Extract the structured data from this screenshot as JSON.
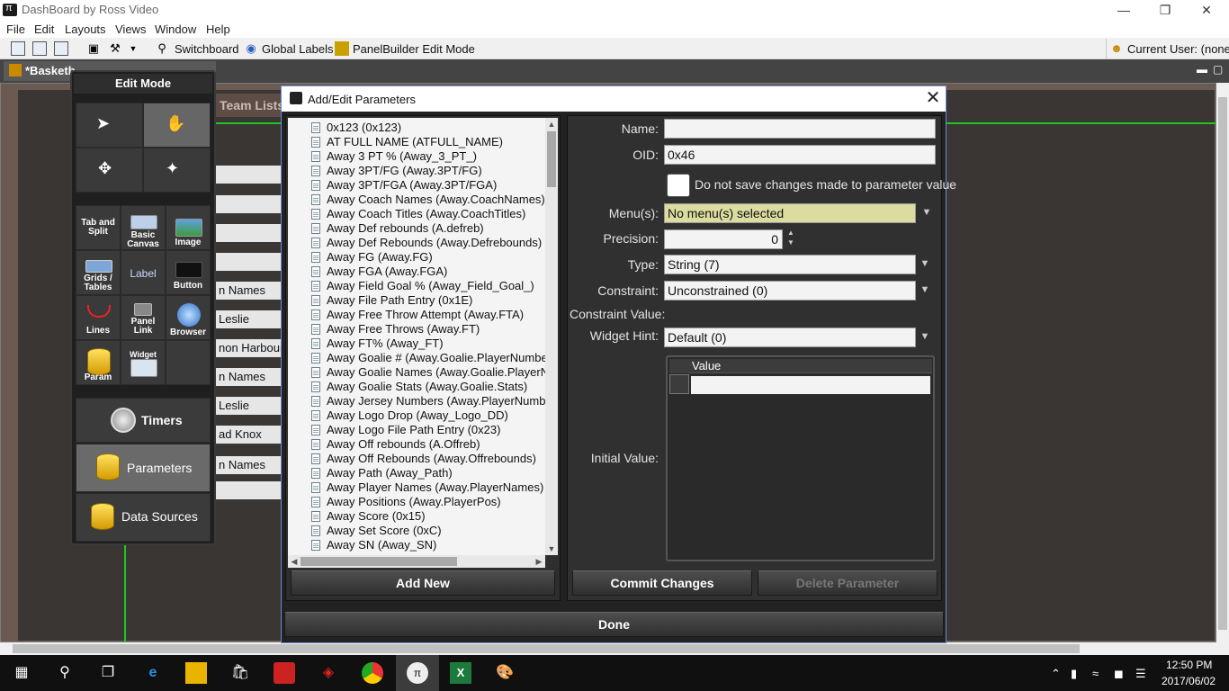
{
  "app": {
    "title": "DashBoard by Ross Video",
    "window_controls": [
      "—",
      "❐",
      "✕"
    ]
  },
  "menu": [
    "File",
    "Edit",
    "Layouts",
    "Views",
    "Window",
    "Help"
  ],
  "toolbar": {
    "switchboard": "Switchboard",
    "global_labels": "Global Labels",
    "panelbuilder": "PanelBuilder Edit Mode",
    "current_user": "Current User: (none)"
  },
  "document_tab": {
    "label": "*Basketb"
  },
  "background_panel": {
    "team_lists": "Team Lists",
    "fields": [
      "",
      "",
      "",
      "",
      "n Names",
      "Leslie",
      "non Harbour",
      "n Names",
      "Leslie",
      "ad Knox",
      "n Names",
      ""
    ]
  },
  "edit_mode": {
    "title": "Edit Mode",
    "tools": [
      {
        "label": "Tab and Split",
        "icon": "tab-split-icon"
      },
      {
        "label": "Basic Canvas",
        "icon": "basic-canvas-icon"
      },
      {
        "label": "Image",
        "icon": "image-icon"
      },
      {
        "label": "Grids / Tables",
        "icon": "grid-icon"
      },
      {
        "label": "Label",
        "icon": "label-icon"
      },
      {
        "label": "Button",
        "icon": "button-icon"
      },
      {
        "label": "Lines",
        "icon": "lines-icon"
      },
      {
        "label": "Panel Link",
        "icon": "panel-link-icon"
      },
      {
        "label": "Browser",
        "icon": "browser-icon"
      },
      {
        "label": "Param",
        "icon": "param-icon"
      },
      {
        "label": "Widget",
        "icon": "widget-icon"
      }
    ],
    "timers": "Timers",
    "parameters": "Parameters",
    "data_sources": "Data Sources"
  },
  "dialog": {
    "title": "Add/Edit Parameters",
    "parameters": [
      "0x123 (0x123)",
      "AT FULL NAME (ATFULL_NAME)",
      "Away 3 PT % (Away_3_PT_)",
      "Away 3PT/FG (Away.3PT/FG)",
      "Away 3PT/FGA (Away.3PT/FGA)",
      "Away Coach Names (Away.CoachNames)",
      "Away Coach Titles (Away.CoachTitles)",
      "Away Def rebounds (A.defreb)",
      "Away Def Rebounds (Away.Defrebounds)",
      "Away FG (Away.FG)",
      "Away FGA (Away.FGA)",
      "Away Field Goal % (Away_Field_Goal_)",
      "Away File Path Entry (0x1E)",
      "Away Free Throw Attempt (Away.FTA)",
      "Away Free Throws (Away.FT)",
      "Away FT% (Away_FT)",
      "Away Goalie # (Away.Goalie.PlayerNumbe",
      "Away Goalie Names (Away.Goalie.PlayerN",
      "Away Goalie Stats (Away.Goalie.Stats)",
      "Away Jersey Numbers (Away.PlayerNumb",
      "Away Logo Drop (Away_Logo_DD)",
      "Away Logo File Path Entry (0x23)",
      "Away Off rebounds (A.Offreb)",
      "Away Off Rebounds (Away.Offrebounds)",
      "Away Path (Away_Path)",
      "Away Player Names (Away.PlayerNames)",
      "Away Positions (Away.PlayerPos)",
      "Away Score (0x15)",
      "Away Set Score (0xC)",
      "Away SN (Away_SN)"
    ],
    "add_new": "Add New",
    "form": {
      "name_label": "Name:",
      "name_value": "",
      "oid_label": "OID:",
      "oid_value": "0x46",
      "no_save_label": "Do not save changes made to parameter value",
      "no_save_checked": false,
      "menus_label": "Menu(s):",
      "menus_value": "No menu(s) selected",
      "precision_label": "Precision:",
      "precision_value": "0",
      "type_label": "Type:",
      "type_value": "String (7)",
      "constraint_label": "Constraint:",
      "constraint_value": "Unconstrained (0)",
      "constraint_value_label": "Constraint Value:",
      "widget_hint_label": "Widget Hint:",
      "widget_hint_value": "Default (0)",
      "initial_value_label": "Initial Value:",
      "value_column": "Value",
      "initial_value": ""
    },
    "commit": "Commit Changes",
    "delete": "Delete Parameter",
    "done": "Done"
  },
  "taskbar": {
    "time": "12:50 PM",
    "date": "2017/06/02"
  },
  "colors": {
    "menus_highlight": "#dcdba0",
    "green_guide": "#21c521",
    "dialog_border": "#6f8bd1"
  }
}
